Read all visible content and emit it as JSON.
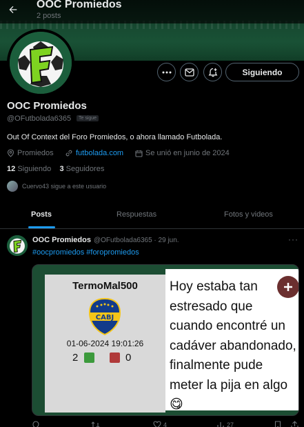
{
  "header": {
    "title": "OOC Promiedos",
    "posts_count": "2 posts"
  },
  "profile": {
    "name": "OOC Promiedos",
    "handle": "@OFutbolada6365",
    "follows_you_badge": "Te sigue",
    "bio": "Out Of Context del Foro Promiedos, o ahora llamado Futbolada.",
    "location": "Promiedos",
    "website": "futbolada.com",
    "joined": "Se unió en junio de 2024",
    "following_count": "12",
    "following_label": "Siguiendo",
    "followers_count": "3",
    "followers_label": "Seguidores",
    "followed_by": "Cuervo43 sigue a este usuario",
    "follow_button": "Siguiendo"
  },
  "tabs": [
    {
      "label": "Posts",
      "active": true
    },
    {
      "label": "Respuestas",
      "active": false
    },
    {
      "label": "Fotos y videos",
      "active": false
    }
  ],
  "tweet": {
    "author_name": "OOC Promiedos",
    "author_handle_date": "@OFutbolada6365 · 29 jun.",
    "hashtags": "#oocpromiedos #foropromiedos",
    "media": {
      "user": "TermoMal500",
      "crest_text": "CABJ",
      "datetime": "01-06-2024 19:01:26",
      "likes": "2",
      "dislikes": "0",
      "text": "Hoy estaba tan estresado que cuando encontré un cadáver abandonado, finalmente pude meter la pija en algo😋"
    },
    "likes": "4",
    "views": "27"
  },
  "colors": {
    "accent": "#1d9bf0",
    "banner": "#1c5b3b"
  }
}
